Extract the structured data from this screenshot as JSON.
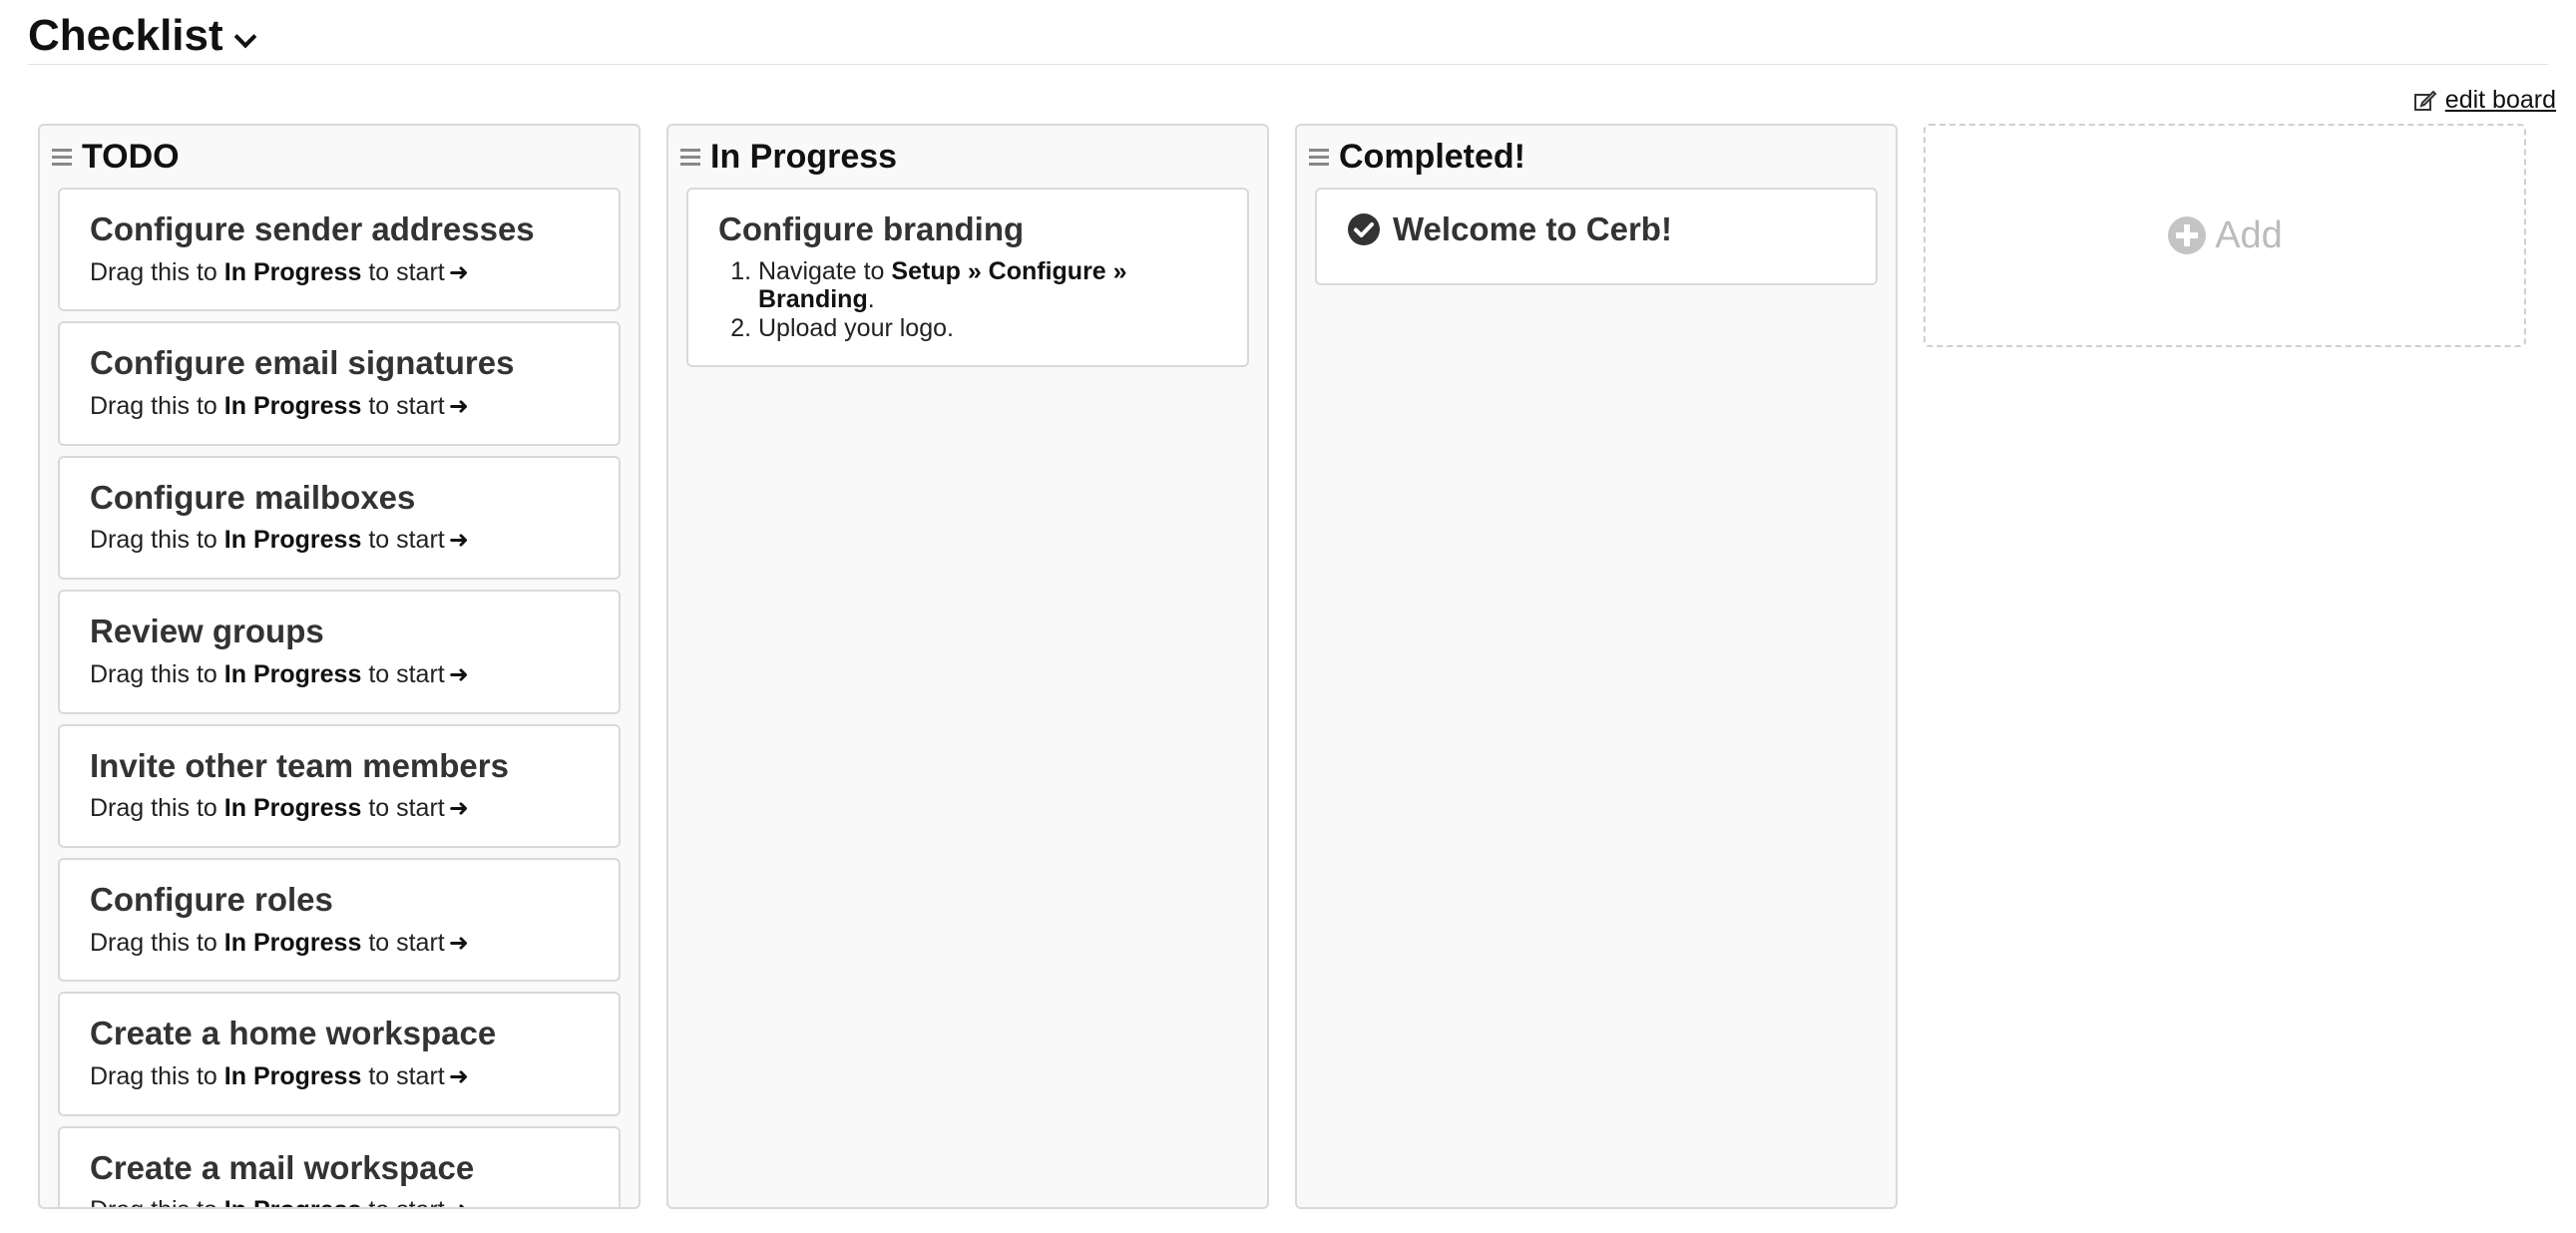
{
  "header": {
    "title": "Checklist",
    "edit_board_label": "edit board"
  },
  "columns": [
    {
      "title": "TODO",
      "cards": [
        {
          "title": "Configure sender addresses",
          "prefix": "Drag this to",
          "target": "In Progress",
          "suffix": "to start"
        },
        {
          "title": "Configure email signatures",
          "prefix": "Drag this to",
          "target": "In Progress",
          "suffix": "to start"
        },
        {
          "title": "Configure mailboxes",
          "prefix": "Drag this to",
          "target": "In Progress",
          "suffix": "to start"
        },
        {
          "title": "Review groups",
          "prefix": "Drag this to",
          "target": "In Progress",
          "suffix": "to start"
        },
        {
          "title": "Invite other team members",
          "prefix": "Drag this to",
          "target": "In Progress",
          "suffix": "to start"
        },
        {
          "title": "Configure roles",
          "prefix": "Drag this to",
          "target": "In Progress",
          "suffix": "to start"
        },
        {
          "title": "Create a home workspace",
          "prefix": "Drag this to",
          "target": "In Progress",
          "suffix": "to start"
        },
        {
          "title": "Create a mail workspace",
          "prefix": "Drag this to",
          "target": "In Progress",
          "suffix": "to start"
        }
      ]
    },
    {
      "title": "In Progress",
      "cards": [
        {
          "title": "Configure branding",
          "steps": {
            "step1_prefix": "Navigate to",
            "step1_path": "Setup » Configure » Branding",
            "step1_suffix": ".",
            "step2": "Upload your logo."
          }
        }
      ]
    },
    {
      "title": "Completed!",
      "cards": [
        {
          "title": "Welcome to Cerb!"
        }
      ]
    }
  ],
  "add_column": {
    "label": "Add"
  },
  "icons": {
    "column_handle": "drag-handle-icon",
    "edit": "edit-icon",
    "completed": "check-circle-icon",
    "add": "plus-circle-icon",
    "card_arrow": "arrow-right-icon",
    "title_dropdown": "chevron-down-icon"
  },
  "colors": {
    "column_bg": "#f9f9f9",
    "card_border": "#d9d9d9",
    "add_text": "#bcbcbc"
  }
}
